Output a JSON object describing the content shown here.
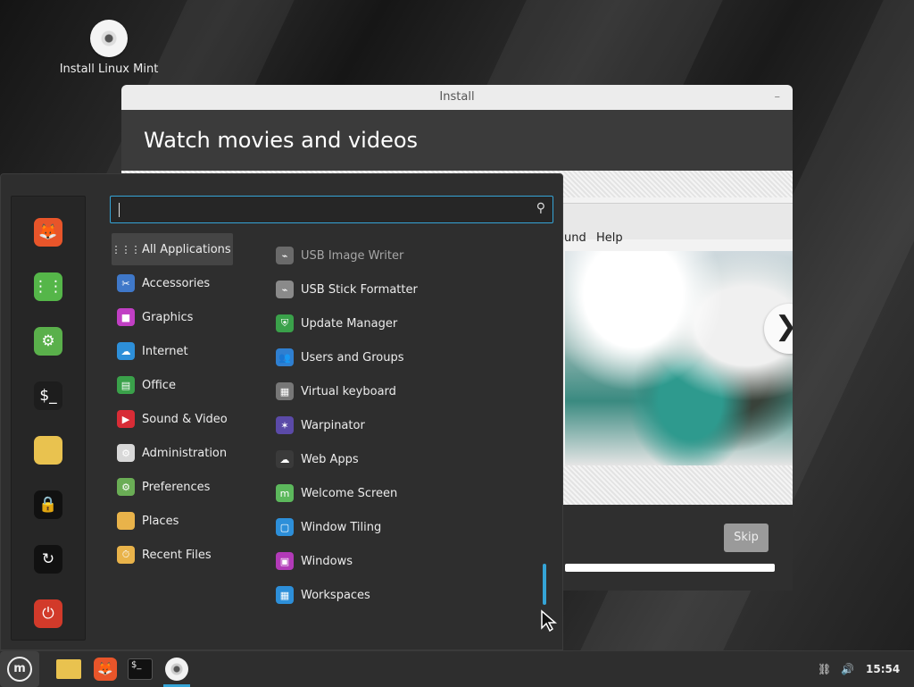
{
  "desktop": {
    "icon_label": "Install Linux Mint"
  },
  "install_window": {
    "title": "Install",
    "heading": "Watch movies and videos",
    "slide_menu": [
      "und",
      "Help"
    ],
    "next_arrow": "❯",
    "skip_label": "Skip",
    "progress_percent": 100
  },
  "menu": {
    "search": {
      "value": "",
      "placeholder": ""
    },
    "favorites": [
      {
        "name": "firefox",
        "glyph": "🦊",
        "color": "#e8552a"
      },
      {
        "name": "software-manager",
        "glyph": "⋮⋮",
        "color": "#55b649"
      },
      {
        "name": "system-settings",
        "glyph": "⚙",
        "color": "#5ab04b"
      },
      {
        "name": "terminal",
        "glyph": "$_",
        "color": "#1d1d1d"
      },
      {
        "name": "files",
        "glyph": "",
        "color": "#e9c24f"
      },
      {
        "name": "lock-screen",
        "glyph": "🔒",
        "color": "#111"
      },
      {
        "name": "logout",
        "glyph": "↻",
        "color": "#111"
      },
      {
        "name": "quit",
        "glyph": "⏻",
        "color": "#d23a2a"
      }
    ],
    "categories": [
      {
        "label": "All Applications",
        "color": "transparent",
        "glyph": "⋮⋮⋮",
        "active": true
      },
      {
        "label": "Accessories",
        "color": "#3f78c9",
        "glyph": "✂"
      },
      {
        "label": "Graphics",
        "color": "#c13fc4",
        "glyph": "■"
      },
      {
        "label": "Internet",
        "color": "#2d8fd9",
        "glyph": "☁"
      },
      {
        "label": "Office",
        "color": "#3aa14a",
        "glyph": "▤"
      },
      {
        "label": "Sound & Video",
        "color": "#d82c36",
        "glyph": "▶"
      },
      {
        "label": "Administration",
        "color": "#d8d8d8",
        "glyph": "⚙"
      },
      {
        "label": "Preferences",
        "color": "#6aad55",
        "glyph": "⚙"
      },
      {
        "label": "Places",
        "color": "#e9b34a",
        "glyph": ""
      },
      {
        "label": "Recent Files",
        "color": "#e9b34a",
        "glyph": "⏱"
      }
    ],
    "apps": [
      {
        "label": "USB Image Writer",
        "color": "#6a6a6a",
        "glyph": "⌁",
        "dim": true
      },
      {
        "label": "USB Stick Formatter",
        "color": "#8a8a8a",
        "glyph": "⌁"
      },
      {
        "label": "Update Manager",
        "color": "#3aa14a",
        "glyph": "⛨"
      },
      {
        "label": "Users and Groups",
        "color": "#2f7fd0",
        "glyph": "👥"
      },
      {
        "label": "Virtual keyboard",
        "color": "#777777",
        "glyph": "▦"
      },
      {
        "label": "Warpinator",
        "color": "#5b4aa8",
        "glyph": "✶"
      },
      {
        "label": "Web Apps",
        "color": "#3a3a3a",
        "glyph": "☁"
      },
      {
        "label": "Welcome Screen",
        "color": "#5cb85c",
        "glyph": "m"
      },
      {
        "label": "Window Tiling",
        "color": "#2d8fd9",
        "glyph": "▢"
      },
      {
        "label": "Windows",
        "color": "#b23ab8",
        "glyph": "▣"
      },
      {
        "label": "Workspaces",
        "color": "#2d8fd9",
        "glyph": "▦"
      }
    ]
  },
  "taskbar": {
    "clock": "15:54",
    "accent": "#35a4d6"
  }
}
